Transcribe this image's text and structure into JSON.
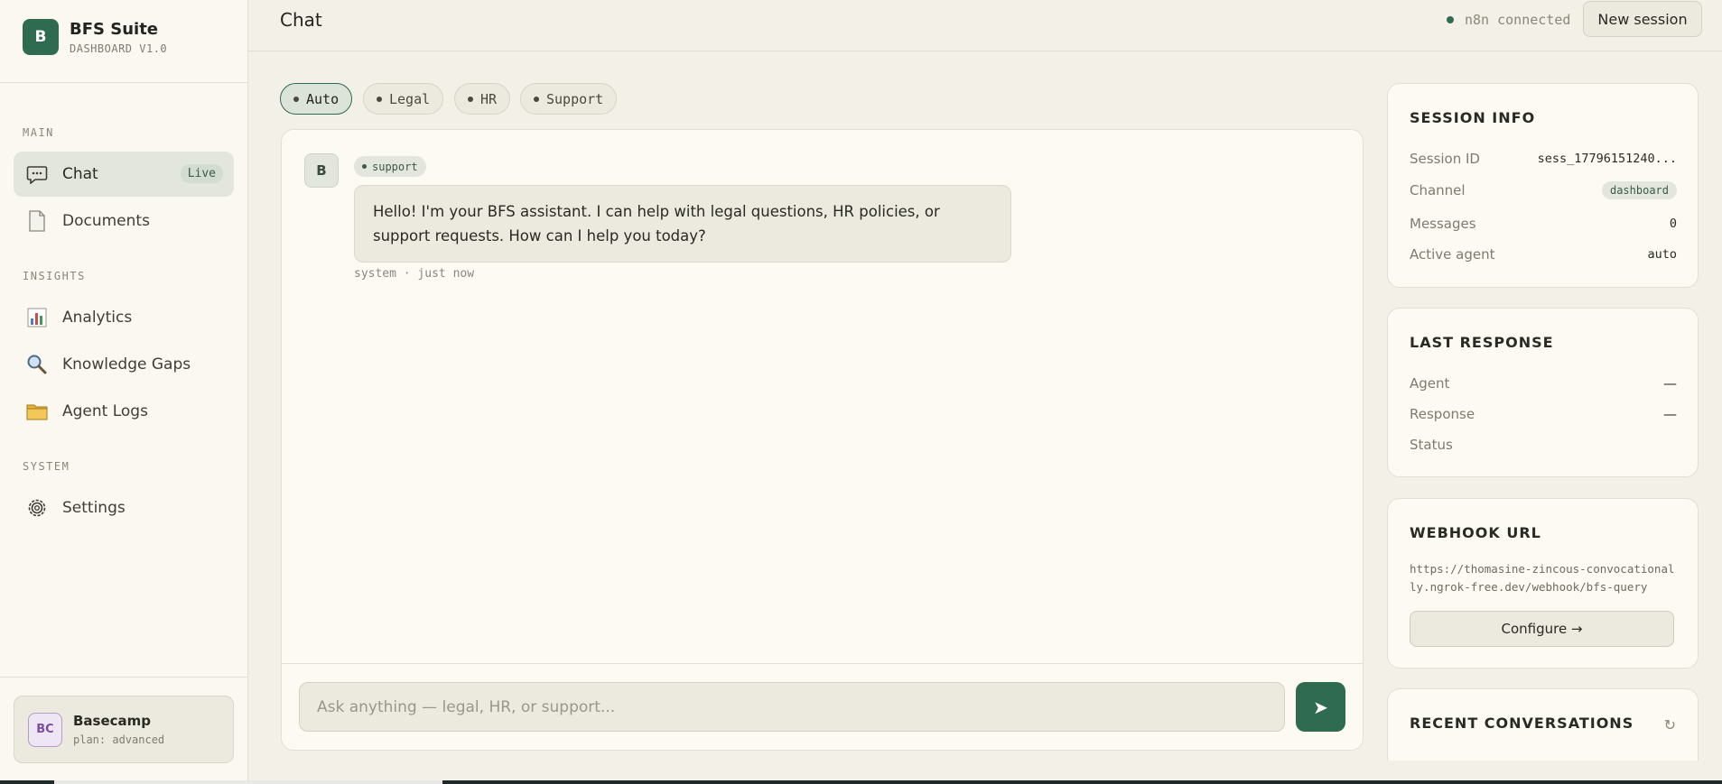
{
  "brand": {
    "logo_letter": "B",
    "name": "BFS Suite",
    "subtitle": "DASHBOARD V1.0"
  },
  "sidebar": {
    "sections": [
      {
        "label": "MAIN"
      },
      {
        "label": "INSIGHTS"
      },
      {
        "label": "SYSTEM"
      }
    ],
    "items": [
      {
        "label": "Chat",
        "icon": "chat-bubble-icon",
        "badge": "Live",
        "active": true
      },
      {
        "label": "Documents",
        "icon": "document-icon"
      },
      {
        "label": "Analytics",
        "icon": "bar-chart-icon"
      },
      {
        "label": "Knowledge Gaps",
        "icon": "magnifier-icon"
      },
      {
        "label": "Agent Logs",
        "icon": "folder-icon"
      },
      {
        "label": "Settings",
        "icon": "gear-icon"
      }
    ],
    "user": {
      "initials": "BC",
      "name": "Basecamp",
      "plan": "plan: advanced"
    }
  },
  "header": {
    "title": "Chat",
    "connection_status": "n8n connected",
    "new_session_label": "New session"
  },
  "agent_chips": [
    {
      "label": "Auto",
      "active": true
    },
    {
      "label": "Legal"
    },
    {
      "label": "HR"
    },
    {
      "label": "Support"
    }
  ],
  "chat": {
    "messages": [
      {
        "avatar": "B",
        "agent_tag": "support",
        "text": "Hello! I'm your BFS assistant. I can help with legal questions, HR policies, or support requests. How can I help you today?",
        "meta": "system · just now"
      }
    ],
    "input_placeholder": "Ask anything — legal, HR, or support...",
    "send_icon": "➤"
  },
  "session_info": {
    "title": "SESSION INFO",
    "rows": [
      {
        "key": "Session ID",
        "value": "sess_17796151240..."
      },
      {
        "key": "Channel",
        "value": "dashboard"
      },
      {
        "key": "Messages",
        "value": "0"
      },
      {
        "key": "Active agent",
        "value": "auto"
      }
    ]
  },
  "last_response": {
    "title": "LAST RESPONSE",
    "rows": [
      {
        "key": "Agent",
        "value": "—"
      },
      {
        "key": "Response",
        "value": "—"
      },
      {
        "key": "Status",
        "value": ""
      }
    ]
  },
  "webhook": {
    "title": "WEBHOOK URL",
    "url": "https://thomasine-zincous-convocationally.ngrok-free.dev/webhook/bfs-query",
    "configure_label": "Configure →"
  },
  "recent_conversations": {
    "title": "RECENT CONVERSATIONS",
    "refresh_icon": "↻"
  },
  "colors": {
    "accent": "#2f6b51",
    "background": "#f3f0e7",
    "panel": "#fcfaf3"
  }
}
